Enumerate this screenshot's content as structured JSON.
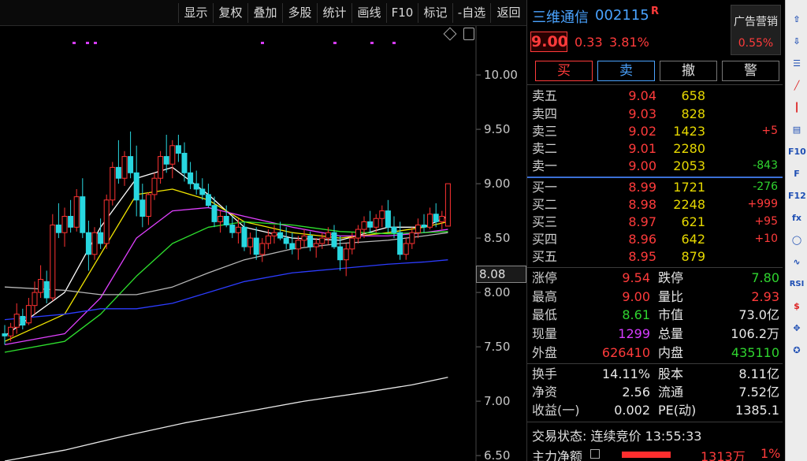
{
  "toolbar": {
    "buttons": [
      "显示",
      "复权",
      "叠加",
      "多股",
      "统计",
      "画线",
      "F10",
      "标记",
      "-自选",
      "返回"
    ]
  },
  "chart": {
    "y_ticks": [
      "10.00",
      "9.50",
      "9.00",
      "8.50",
      "8.00",
      "7.50",
      "7.00",
      "6.50"
    ],
    "current_price_label": "8.08"
  },
  "chart_data": {
    "type": "candlestick",
    "ylim": [
      6.45,
      10.45
    ],
    "y_ticks": [
      10.0,
      9.5,
      9.0,
      8.5,
      8.0,
      7.5,
      7.0,
      6.5
    ],
    "ohlc": [
      [
        7.62,
        7.7,
        7.52,
        7.6
      ],
      [
        7.6,
        7.72,
        7.55,
        7.68
      ],
      [
        7.68,
        7.9,
        7.62,
        7.8
      ],
      [
        7.78,
        7.85,
        7.66,
        7.7
      ],
      [
        7.72,
        7.95,
        7.7,
        7.88
      ],
      [
        7.88,
        8.1,
        7.8,
        8.0
      ],
      [
        8.0,
        8.25,
        7.95,
        8.12
      ],
      [
        8.1,
        8.2,
        7.9,
        7.95
      ],
      [
        7.95,
        8.72,
        7.92,
        8.62
      ],
      [
        8.62,
        8.82,
        8.5,
        8.55
      ],
      [
        8.55,
        8.78,
        8.42,
        8.7
      ],
      [
        8.7,
        8.85,
        8.55,
        8.6
      ],
      [
        8.6,
        8.95,
        8.56,
        8.88
      ],
      [
        8.88,
        9.05,
        8.5,
        8.55
      ],
      [
        8.55,
        8.66,
        8.2,
        8.35
      ],
      [
        8.35,
        8.6,
        8.3,
        8.55
      ],
      [
        8.55,
        8.68,
        8.4,
        8.45
      ],
      [
        8.45,
        8.9,
        8.4,
        8.85
      ],
      [
        8.85,
        9.2,
        8.8,
        9.15
      ],
      [
        9.15,
        9.4,
        9.0,
        9.05
      ],
      [
        9.05,
        9.3,
        8.98,
        9.25
      ],
      [
        9.25,
        9.48,
        9.05,
        9.1
      ],
      [
        9.1,
        9.35,
        8.7,
        8.85
      ],
      [
        8.85,
        9.0,
        8.6,
        8.7
      ],
      [
        8.7,
        8.92,
        8.62,
        8.9
      ],
      [
        8.9,
        9.1,
        8.85,
        9.05
      ],
      [
        9.05,
        9.3,
        9.0,
        9.25
      ],
      [
        9.25,
        9.45,
        9.1,
        9.18
      ],
      [
        9.18,
        9.4,
        9.05,
        9.35
      ],
      [
        9.35,
        9.45,
        9.2,
        9.28
      ],
      [
        9.28,
        9.38,
        9.02,
        9.1
      ],
      [
        9.1,
        9.2,
        8.95,
        9.0
      ],
      [
        9.0,
        9.12,
        8.9,
        8.95
      ],
      [
        8.95,
        9.05,
        8.85,
        8.9
      ],
      [
        8.9,
        9.0,
        8.78,
        8.8
      ],
      [
        8.8,
        8.88,
        8.6,
        8.65
      ],
      [
        8.65,
        8.75,
        8.55,
        8.7
      ],
      [
        8.7,
        8.8,
        8.6,
        8.62
      ],
      [
        8.62,
        8.7,
        8.5,
        8.55
      ],
      [
        8.55,
        8.68,
        8.45,
        8.6
      ],
      [
        8.6,
        8.65,
        8.38,
        8.42
      ],
      [
        8.42,
        8.55,
        8.35,
        8.5
      ],
      [
        8.5,
        8.6,
        8.3,
        8.35
      ],
      [
        8.35,
        8.5,
        8.28,
        8.45
      ],
      [
        8.45,
        8.58,
        8.4,
        8.52
      ],
      [
        8.52,
        8.62,
        8.45,
        8.55
      ],
      [
        8.55,
        8.65,
        8.48,
        8.5
      ],
      [
        8.5,
        8.6,
        8.4,
        8.45
      ],
      [
        8.45,
        8.55,
        8.35,
        8.4
      ],
      [
        8.4,
        8.52,
        8.3,
        8.48
      ],
      [
        8.48,
        8.58,
        8.42,
        8.52
      ],
      [
        8.52,
        8.56,
        8.38,
        8.42
      ],
      [
        8.42,
        8.5,
        8.32,
        8.45
      ],
      [
        8.45,
        8.55,
        8.4,
        8.5
      ],
      [
        8.5,
        8.6,
        8.44,
        8.55
      ],
      [
        8.55,
        8.62,
        8.4,
        8.42
      ],
      [
        8.42,
        8.52,
        8.2,
        8.3
      ],
      [
        8.3,
        8.45,
        8.15,
        8.4
      ],
      [
        8.4,
        8.55,
        8.35,
        8.5
      ],
      [
        8.5,
        8.62,
        8.45,
        8.58
      ],
      [
        8.58,
        8.7,
        8.5,
        8.65
      ],
      [
        8.65,
        8.75,
        8.55,
        8.6
      ],
      [
        8.6,
        8.72,
        8.55,
        8.68
      ],
      [
        8.68,
        8.8,
        8.6,
        8.75
      ],
      [
        8.75,
        8.85,
        8.55,
        8.6
      ],
      [
        8.6,
        8.7,
        8.5,
        8.55
      ],
      [
        8.55,
        8.65,
        8.3,
        8.35
      ],
      [
        8.35,
        8.5,
        8.3,
        8.45
      ],
      [
        8.45,
        8.6,
        8.4,
        8.55
      ],
      [
        8.55,
        8.68,
        8.5,
        8.62
      ],
      [
        8.62,
        8.72,
        8.55,
        8.6
      ],
      [
        8.6,
        8.78,
        8.58,
        8.72
      ],
      [
        8.72,
        8.82,
        8.6,
        8.65
      ],
      [
        8.65,
        8.75,
        8.58,
        8.7
      ],
      [
        8.61,
        9.0,
        8.61,
        9.0
      ]
    ],
    "moving_averages": [
      {
        "color": "#ffffff",
        "points": [
          [
            0,
            7.6
          ],
          [
            10,
            8.0
          ],
          [
            16,
            8.6
          ],
          [
            22,
            9.05
          ],
          [
            28,
            9.15
          ],
          [
            34,
            8.9
          ],
          [
            40,
            8.6
          ],
          [
            48,
            8.5
          ],
          [
            56,
            8.48
          ],
          [
            64,
            8.6
          ],
          [
            70,
            8.6
          ],
          [
            74,
            8.7
          ]
        ]
      },
      {
        "color": "#f2e600",
        "points": [
          [
            0,
            7.55
          ],
          [
            10,
            7.8
          ],
          [
            16,
            8.35
          ],
          [
            22,
            8.9
          ],
          [
            28,
            8.95
          ],
          [
            34,
            8.85
          ],
          [
            40,
            8.65
          ],
          [
            48,
            8.55
          ],
          [
            56,
            8.5
          ],
          [
            64,
            8.55
          ],
          [
            70,
            8.6
          ],
          [
            74,
            8.65
          ]
        ]
      },
      {
        "color": "#e040ff",
        "points": [
          [
            0,
            7.52
          ],
          [
            10,
            7.62
          ],
          [
            16,
            7.95
          ],
          [
            22,
            8.5
          ],
          [
            28,
            8.75
          ],
          [
            34,
            8.78
          ],
          [
            40,
            8.7
          ],
          [
            48,
            8.6
          ],
          [
            56,
            8.52
          ],
          [
            64,
            8.52
          ],
          [
            70,
            8.55
          ],
          [
            74,
            8.58
          ]
        ]
      },
      {
        "color": "#2ee02e",
        "points": [
          [
            0,
            7.45
          ],
          [
            10,
            7.55
          ],
          [
            16,
            7.8
          ],
          [
            22,
            8.15
          ],
          [
            28,
            8.45
          ],
          [
            34,
            8.6
          ],
          [
            40,
            8.65
          ],
          [
            48,
            8.62
          ],
          [
            56,
            8.56
          ],
          [
            64,
            8.54
          ],
          [
            70,
            8.55
          ],
          [
            74,
            8.56
          ]
        ]
      },
      {
        "color": "#b8b8b8",
        "points": [
          [
            0,
            8.05
          ],
          [
            10,
            8.02
          ],
          [
            16,
            7.98
          ],
          [
            22,
            7.98
          ],
          [
            28,
            8.05
          ],
          [
            34,
            8.18
          ],
          [
            40,
            8.3
          ],
          [
            48,
            8.4
          ],
          [
            56,
            8.45
          ],
          [
            64,
            8.48
          ],
          [
            70,
            8.52
          ],
          [
            74,
            8.55
          ]
        ]
      },
      {
        "color": "#2c3cff",
        "points": [
          [
            0,
            7.75
          ],
          [
            10,
            7.8
          ],
          [
            16,
            7.85
          ],
          [
            22,
            7.85
          ],
          [
            28,
            7.9
          ],
          [
            34,
            8.0
          ],
          [
            40,
            8.1
          ],
          [
            48,
            8.18
          ],
          [
            56,
            8.22
          ],
          [
            64,
            8.26
          ],
          [
            70,
            8.28
          ],
          [
            74,
            8.3
          ]
        ]
      },
      {
        "color": "#e8e8e8",
        "points": [
          [
            0,
            6.45
          ],
          [
            10,
            6.55
          ],
          [
            20,
            6.68
          ],
          [
            30,
            6.8
          ],
          [
            40,
            6.9
          ],
          [
            50,
            7.0
          ],
          [
            60,
            7.08
          ],
          [
            68,
            7.15
          ],
          [
            74,
            7.22
          ]
        ]
      }
    ],
    "markers_count": 9
  },
  "stock": {
    "name": "三维通信",
    "code": "002115",
    "flag": "R",
    "price": "9.00",
    "change": "0.33",
    "change_pct": "3.81%",
    "ad_label": "广告营销",
    "ad_pct": "0.55%"
  },
  "trade_buttons": [
    "买",
    "卖",
    "撤",
    "警"
  ],
  "order_book": {
    "asks": [
      {
        "label": "卖五",
        "price": "9.04",
        "vol": "658",
        "chg": ""
      },
      {
        "label": "卖四",
        "price": "9.03",
        "vol": "828",
        "chg": ""
      },
      {
        "label": "卖三",
        "price": "9.02",
        "vol": "1423",
        "chg": "+5"
      },
      {
        "label": "卖二",
        "price": "9.01",
        "vol": "2280",
        "chg": ""
      },
      {
        "label": "卖一",
        "price": "9.00",
        "vol": "2053",
        "chg": "-843"
      }
    ],
    "bids": [
      {
        "label": "买一",
        "price": "8.99",
        "vol": "1721",
        "chg": "-276"
      },
      {
        "label": "买二",
        "price": "8.98",
        "vol": "2248",
        "chg": "+999"
      },
      {
        "label": "买三",
        "price": "8.97",
        "vol": "621",
        "chg": "+95"
      },
      {
        "label": "买四",
        "price": "8.96",
        "vol": "642",
        "chg": "+10"
      },
      {
        "label": "买五",
        "price": "8.95",
        "vol": "879",
        "chg": ""
      }
    ]
  },
  "stats": {
    "limit_up_label": "涨停",
    "limit_up": "9.54",
    "limit_down_label": "跌停",
    "limit_down": "7.80",
    "high_label": "最高",
    "high": "9.00",
    "vol_ratio_label": "量比",
    "vol_ratio": "2.93",
    "low_label": "最低",
    "low": "8.61",
    "mkt_cap_label": "市值",
    "mkt_cap": "73.0亿",
    "cur_vol_label": "现量",
    "cur_vol": "1299",
    "total_vol_label": "总量",
    "total_vol": "106.2万",
    "outer_label": "外盘",
    "outer": "626410",
    "inner_label": "内盘",
    "inner": "435110",
    "turnover_label": "换手",
    "turnover": "14.11%",
    "equity_label": "股本",
    "equity": "8.11亿",
    "nav_label": "净资",
    "nav": "2.56",
    "float_label": "流通",
    "float": "7.52亿",
    "eps_label": "收益(一)",
    "eps": "0.002",
    "pe_label": "PE(动)",
    "pe": "1385.1"
  },
  "status": {
    "trade_state": "交易状态: 连续竞价 13:55:33",
    "main_flow_label": "主力净额",
    "main_flow_value": "1313万",
    "main_flow_pct": "1%"
  },
  "side_icons": [
    "arrow-up-icon",
    "arrow-down-icon",
    "grid-list-icon",
    "line-chart-icon",
    "candle-icon",
    "table-icon",
    "f10-icon",
    "function-icon",
    "f12-icon",
    "fx-icon",
    "circle-icon",
    "wave-icon",
    "rsi-icon",
    "dollar-icon",
    "move-icon",
    "gear-icon"
  ],
  "side_labels": [
    "⇧",
    "⇩",
    "☰",
    "╱",
    "┃",
    "▤",
    "F10",
    "F",
    "F12",
    "fx",
    "◯",
    "∿",
    "RSI",
    "$",
    "✥",
    "✪"
  ]
}
